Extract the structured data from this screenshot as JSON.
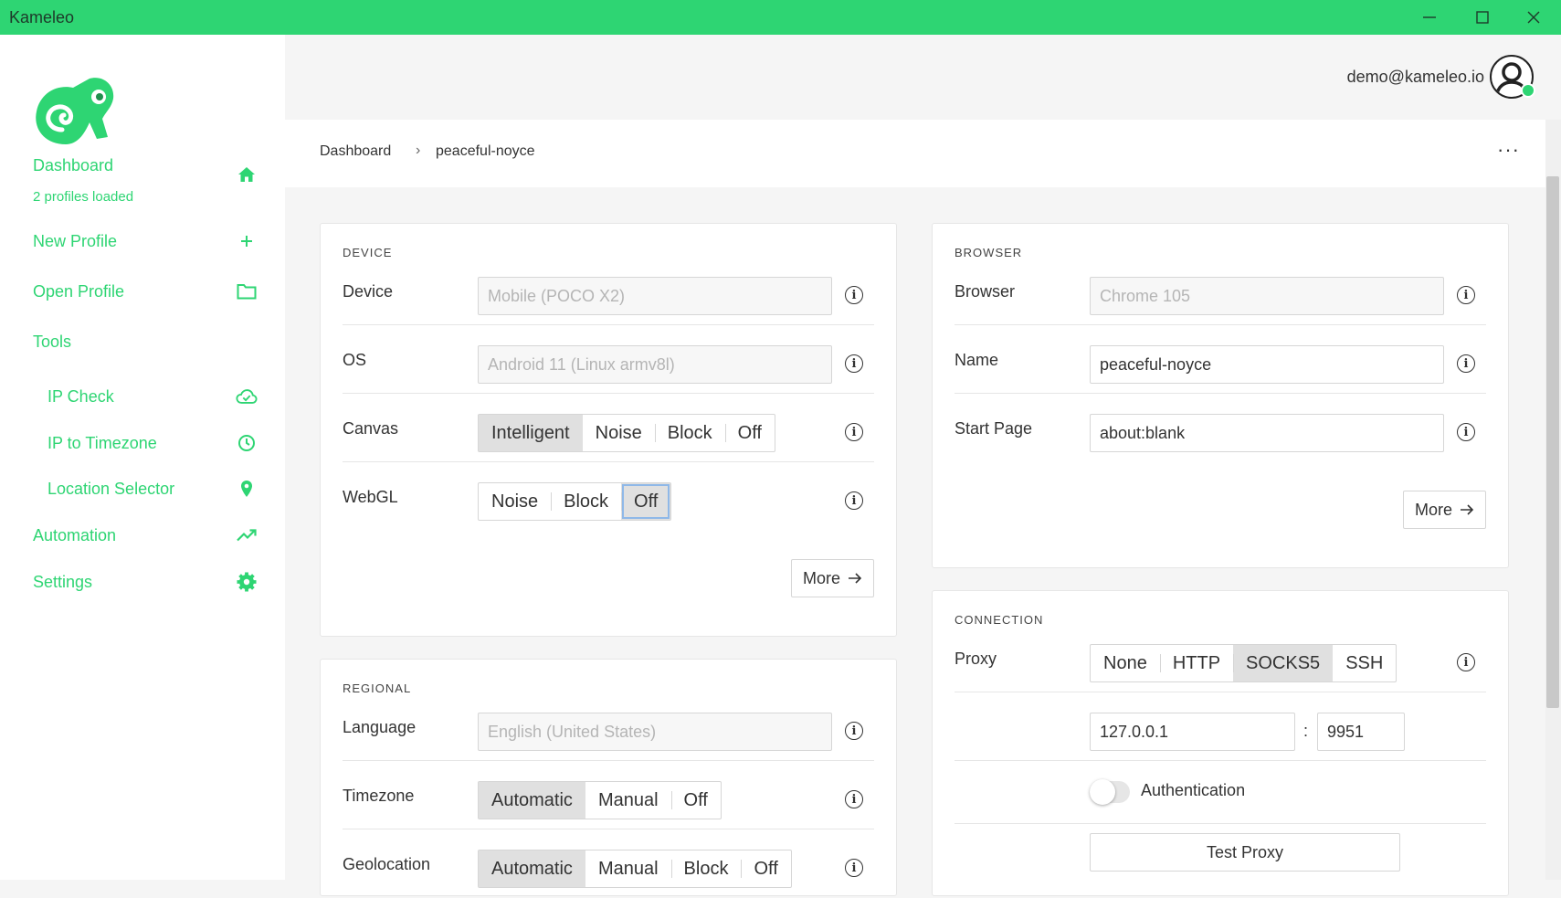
{
  "window": {
    "title": "Kameleo"
  },
  "sidebar": {
    "dashboard_label": "Dashboard",
    "dashboard_caption": "2 profiles loaded",
    "new_profile_label": "New Profile",
    "open_profile_label": "Open Profile",
    "tools_label": "Tools",
    "ip_check_label": "IP Check",
    "ip_timezone_label": "IP to Timezone",
    "location_selector_label": "Location Selector",
    "automation_label": "Automation",
    "settings_label": "Settings"
  },
  "header": {
    "user_email": "demo@kameleo.io"
  },
  "breadcrumb": {
    "root": "Dashboard",
    "separator": "›",
    "current": "peaceful-noyce",
    "more": "···"
  },
  "device": {
    "title": "DEVICE",
    "device_label": "Device",
    "device_placeholder": "Mobile (POCO X2)",
    "os_label": "OS",
    "os_placeholder": "Android 11 (Linux armv8l)",
    "canvas_label": "Canvas",
    "canvas_options": [
      "Intelligent",
      "Noise",
      "Block",
      "Off"
    ],
    "canvas_selected": "Intelligent",
    "webgl_label": "WebGL",
    "webgl_options": [
      "Noise",
      "Block",
      "Off"
    ],
    "webgl_selected": "Off",
    "more_label": "More"
  },
  "regional": {
    "title": "REGIONAL",
    "language_label": "Language",
    "language_placeholder": "English (United States)",
    "timezone_label": "Timezone",
    "timezone_options": [
      "Automatic",
      "Manual",
      "Off"
    ],
    "timezone_selected": "Automatic",
    "geolocation_label": "Geolocation",
    "geolocation_options": [
      "Automatic",
      "Manual",
      "Block",
      "Off"
    ],
    "geolocation_selected": "Automatic"
  },
  "browser": {
    "title": "BROWSER",
    "browser_label": "Browser",
    "browser_placeholder": "Chrome 105",
    "name_label": "Name",
    "name_value": "peaceful-noyce",
    "start_page_label": "Start Page",
    "start_page_value": "about:blank",
    "more_label": "More"
  },
  "connection": {
    "title": "CONNECTION",
    "proxy_label": "Proxy",
    "proxy_options": [
      "None",
      "HTTP",
      "SOCKS5",
      "SSH"
    ],
    "proxy_selected": "SOCKS5",
    "host_value": "127.0.0.1",
    "port_separator": ":",
    "port_value": "9951",
    "auth_label": "Authentication",
    "test_proxy_label": "Test Proxy"
  },
  "colors": {
    "brand": "#2ed573",
    "surface": "#ffffff",
    "background": "#f5f5f5"
  }
}
